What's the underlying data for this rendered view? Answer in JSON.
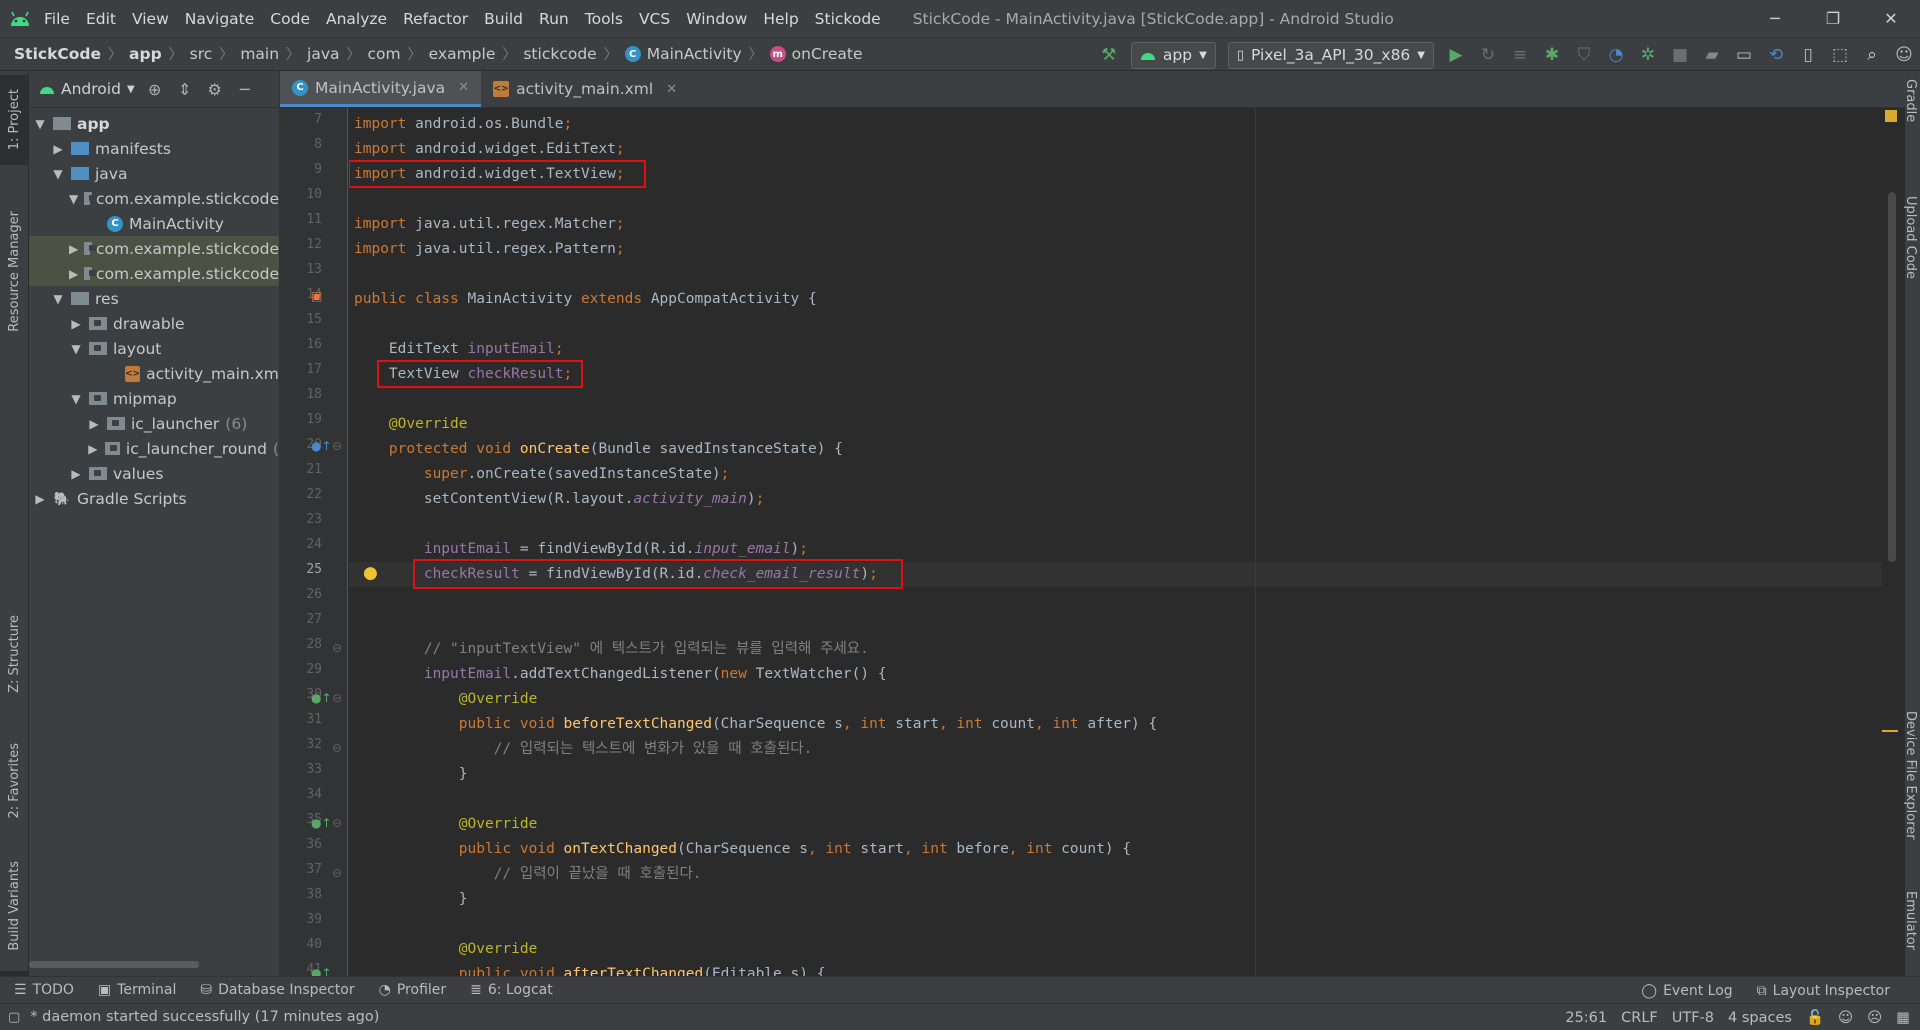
{
  "window": {
    "title": "StickCode - MainActivity.java [StickCode.app] - Android Studio",
    "menu": [
      "File",
      "Edit",
      "View",
      "Navigate",
      "Code",
      "Analyze",
      "Refactor",
      "Build",
      "Run",
      "Tools",
      "VCS",
      "Window",
      "Help",
      "Stickode"
    ],
    "controls": {
      "minimize": "─",
      "restore": "❐",
      "close": "✕"
    }
  },
  "breadcrumbs": [
    "StickCode",
    "app",
    "src",
    "main",
    "java",
    "com",
    "example",
    "stickcode",
    "MainActivity",
    "onCreate"
  ],
  "toolbar": {
    "run_config": "app",
    "device": "Pixel_3a_API_30_x86"
  },
  "left_tabs": {
    "project": "1: Project",
    "resource_manager": "Resource Manager",
    "structure": "Z: Structure",
    "favorites": "2: Favorites",
    "build_variants": "Build Variants"
  },
  "right_tabs": {
    "gradle": "Gradle",
    "upload_code": "Upload Code",
    "device_file_explorer": "Device File Explorer",
    "emulator": "Emulator"
  },
  "project_panel": {
    "view": "Android",
    "tree": [
      {
        "label": "app",
        "count": ""
      },
      {
        "label": "manifests",
        "count": ""
      },
      {
        "label": "java",
        "count": ""
      },
      {
        "label": "com.example.stickcode",
        "count": ""
      },
      {
        "label": "MainActivity",
        "count": ""
      },
      {
        "label": "com.example.stickcode",
        "count": ""
      },
      {
        "label": "com.example.stickcode",
        "count": ""
      },
      {
        "label": "res",
        "count": ""
      },
      {
        "label": "drawable",
        "count": ""
      },
      {
        "label": "layout",
        "count": ""
      },
      {
        "label": "activity_main.xml",
        "count": ""
      },
      {
        "label": "mipmap",
        "count": ""
      },
      {
        "label": "ic_launcher",
        "count": "(6)"
      },
      {
        "label": "ic_launcher_round",
        "count": "("
      },
      {
        "label": "values",
        "count": ""
      },
      {
        "label": "Gradle Scripts",
        "count": ""
      }
    ]
  },
  "editor_tabs": [
    {
      "label": "MainActivity.java"
    },
    {
      "label": "activity_main.xml"
    }
  ],
  "editor": {
    "line_numbers": [
      "7",
      "8",
      "9",
      "10",
      "11",
      "12",
      "13",
      "14",
      "15",
      "16",
      "17",
      "18",
      "19",
      "20",
      "21",
      "22",
      "23",
      "24",
      "25",
      "26",
      "27",
      "28",
      "29",
      "30",
      "31",
      "32",
      "33",
      "34",
      "35",
      "36",
      "37",
      "38",
      "39",
      "40",
      "41"
    ],
    "current_line": "25",
    "comment_input": "// \"inputTextView\" 에 텍스트가 입력되는 뷰를 입력해 주세요.",
    "comment_before": "// 입력되는 텍스트에 변화가 있을 때 호출된다.",
    "comment_on": "// 입력이 끝났을 때 호출된다."
  },
  "bottom_tools": {
    "todo": "TODO",
    "terminal": "Terminal",
    "database": "Database Inspector",
    "profiler": "Profiler",
    "logcat": "6: Logcat",
    "event_log": "Event Log",
    "layout_inspector": "Layout Inspector"
  },
  "status": {
    "message": "* daemon started successfully (17 minutes ago)",
    "position": "25:61",
    "line_sep": "CRLF",
    "encoding": "UTF-8",
    "indent": "4 spaces"
  },
  "colors": {
    "highlight_box": "#e01010",
    "keyword": "#cc7832",
    "field": "#9876aa",
    "annotation": "#bbb529",
    "method": "#ffc66d"
  }
}
